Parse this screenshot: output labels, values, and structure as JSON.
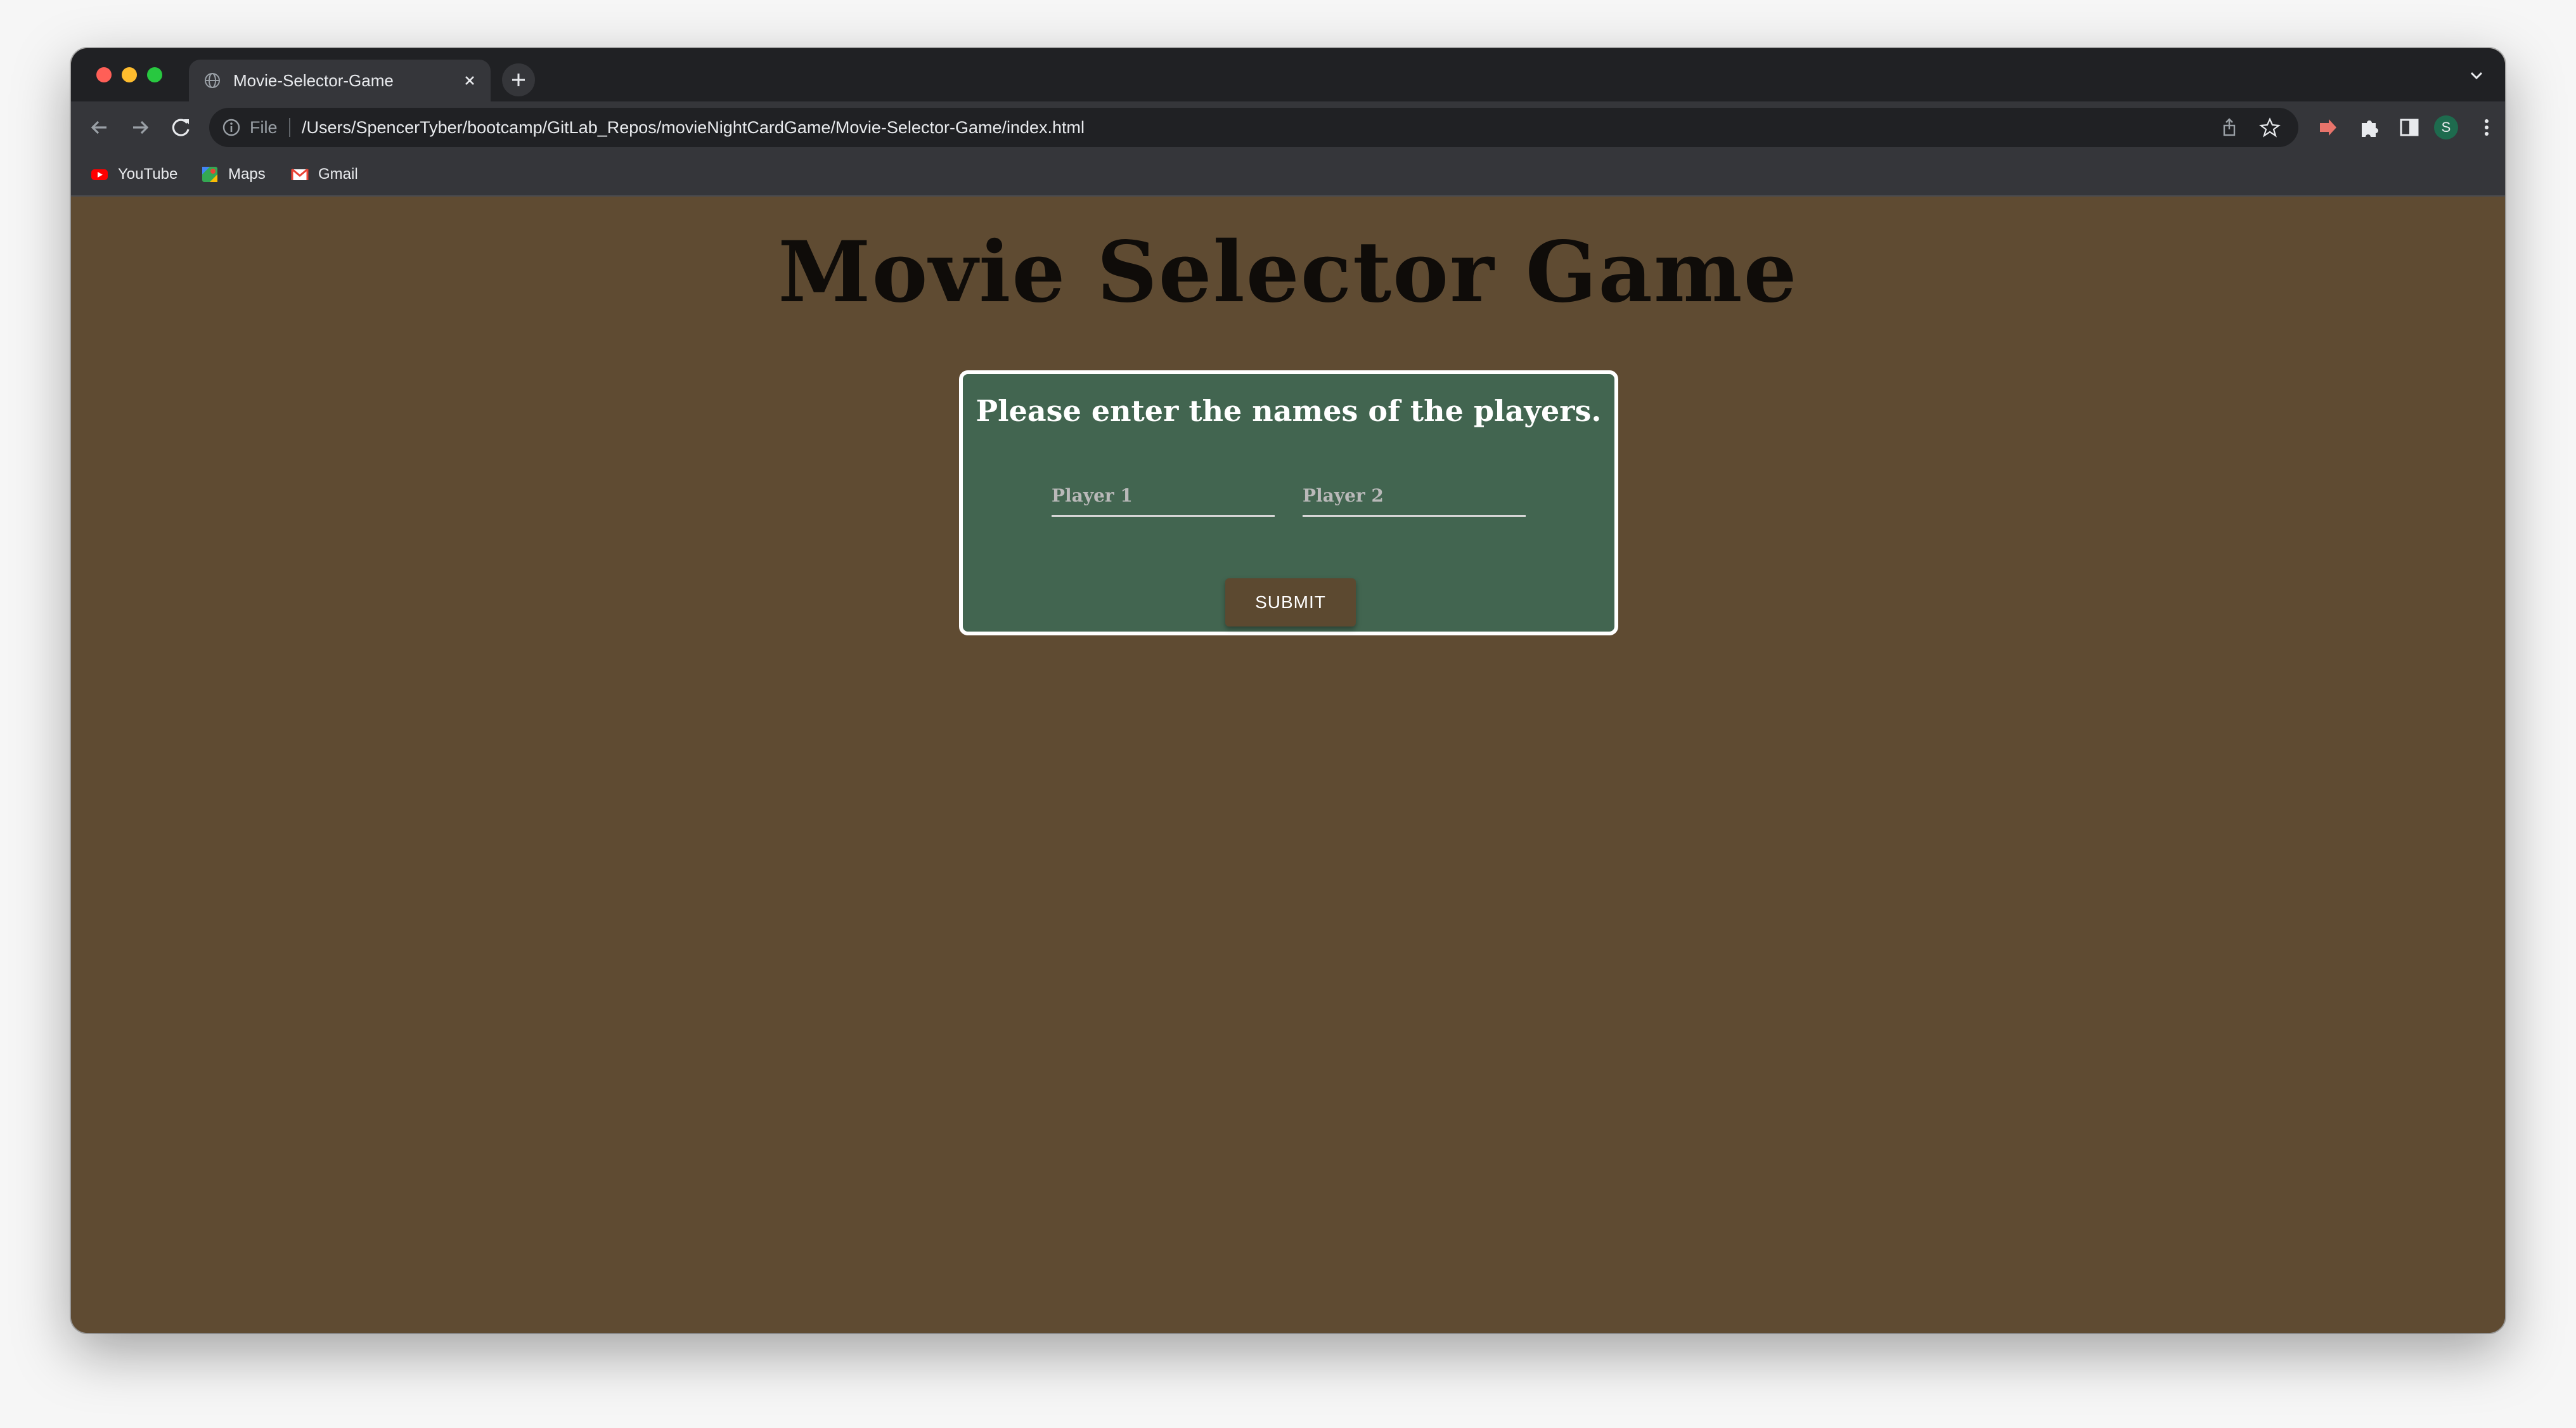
{
  "browser": {
    "tab": {
      "title": "Movie-Selector-Game"
    },
    "address_bar": {
      "scheme_label": "File",
      "url": "/Users/SpencerTyber/bootcamp/GitLab_Repos/movieNightCardGame/Movie-Selector-Game/index.html"
    },
    "profile_initial": "S",
    "bookmarks": [
      {
        "label": "YouTube",
        "icon": "youtube-icon"
      },
      {
        "label": "Maps",
        "icon": "maps-icon"
      },
      {
        "label": "Gmail",
        "icon": "gmail-icon"
      }
    ]
  },
  "page": {
    "title": "Movie Selector Game",
    "form": {
      "heading": "Please enter the names of the players.",
      "player1_placeholder": "Player 1",
      "player2_placeholder": "Player 2",
      "submit_label": "SUBMIT"
    }
  },
  "colors": {
    "page_background": "#5f4b32",
    "card_background": "#426550",
    "card_border": "#ffffff",
    "submit_background": "#5c4930"
  }
}
